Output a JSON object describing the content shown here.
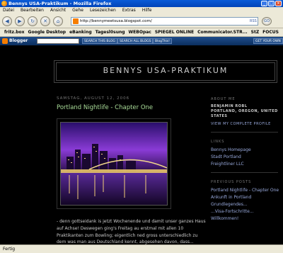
{
  "window": {
    "title": "Bennys USA-Praktikum - Mozilla Firefox"
  },
  "menu": [
    "Datei",
    "Bearbeiten",
    "Ansicht",
    "Gehe",
    "Lesezeichen",
    "Extras",
    "Hilfe"
  ],
  "nav": {
    "url": "http://bennymeetsusa.blogspot.com/",
    "rss": "RSS",
    "go": "GO"
  },
  "bookmarks": [
    "fritz.box",
    "Google Desktop",
    "eBanking",
    "Tagesl0sung",
    "WEBOpac",
    "SPIEGEL ONLINE",
    "Communicator.STR...",
    "StZ",
    "FOCUS"
  ],
  "blogger": {
    "brand": "Blogger",
    "search_blog": "SEARCH THIS BLOG",
    "search_all": "SEARCH ALL BLOGS",
    "blogthis": "BlogThis!",
    "get_own": "GET YOUR OWN"
  },
  "blog": {
    "title": "BENNYS USA-PRAKTIKUM"
  },
  "post": {
    "date": "SAMSTAG, AUGUST 12, 2006",
    "title": "Portland Nightlife - Chapter One",
    "body_lines": [
      "- denn gottseidank is jetzt Wochenende und damit unser ganzes Haus",
      "auf Achse! Deswegen ging's Freitag au erstmal mit allen 10",
      "Praktikanten zum Bowling; eigentlich ned gross unterschiedlich zu",
      "dem was man aus Deutschland kennt, abgesehen davon, dass..."
    ]
  },
  "sidebar": {
    "about_heading": "ABOUT ME",
    "name": "BENJAMIN ROBL",
    "location": "PORTLAND, OREGON, UNITED STATES",
    "profile_link": "VIEW MY COMPLETE PROFILE",
    "links_heading": "LINKS",
    "links": [
      "Bennys Homepage",
      "Stadt Portland",
      "Freightliner LLC"
    ],
    "prev_heading": "PREVIOUS POSTS",
    "prev_posts": [
      "Portland Nightlife - Chapter One",
      "Ankunft in Portland",
      "Grundlegendes...",
      "...Visa-Fortschritte...",
      "Willkommen!"
    ]
  },
  "status": {
    "text": "Fertig"
  },
  "colors": {
    "title_bar": "#0a5bd8",
    "post_title": "#aadd99",
    "link": "#99aadd",
    "chrome": "#ece9d8"
  }
}
